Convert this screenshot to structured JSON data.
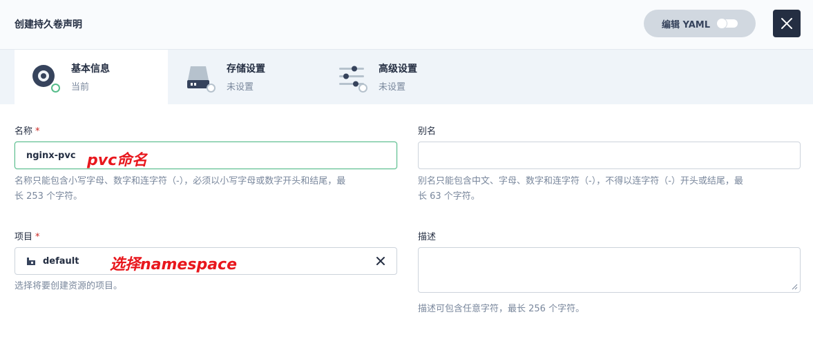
{
  "header": {
    "title": "创建持久卷声明",
    "yaml_label": "编辑 YAML"
  },
  "tabs": [
    {
      "title": "基本信息",
      "status": "当前"
    },
    {
      "title": "存储设置",
      "status": "未设置"
    },
    {
      "title": "高级设置",
      "status": "未设置"
    }
  ],
  "form": {
    "name": {
      "label": "名称",
      "required": "*",
      "value": "nginx-pvc",
      "help_line1": "名称只能包含小写字母、数字和连字符（-），必须以小写字母或数字开头和结尾，最",
      "help_line2": "长 253 个字符。"
    },
    "alias": {
      "label": "别名",
      "value": "",
      "help_line1": "别名只能包含中文、字母、数字和连字符（-），不得以连字符（-）开头或结尾，最",
      "help_line2": "长 63 个字符。"
    },
    "project": {
      "label": "项目",
      "required": "*",
      "value": "default",
      "help": "选择将要创建资源的项目。"
    },
    "description": {
      "label": "描述",
      "value": "",
      "help": "描述可包含任意字符，最长 256 个字符。"
    }
  },
  "annotations": {
    "name_note": "pvc命名",
    "project_note": "选择namespace"
  },
  "colors": {
    "accent_green": "#55bc8a",
    "dark": "#242e42",
    "annotation_red": "#e8171d"
  }
}
